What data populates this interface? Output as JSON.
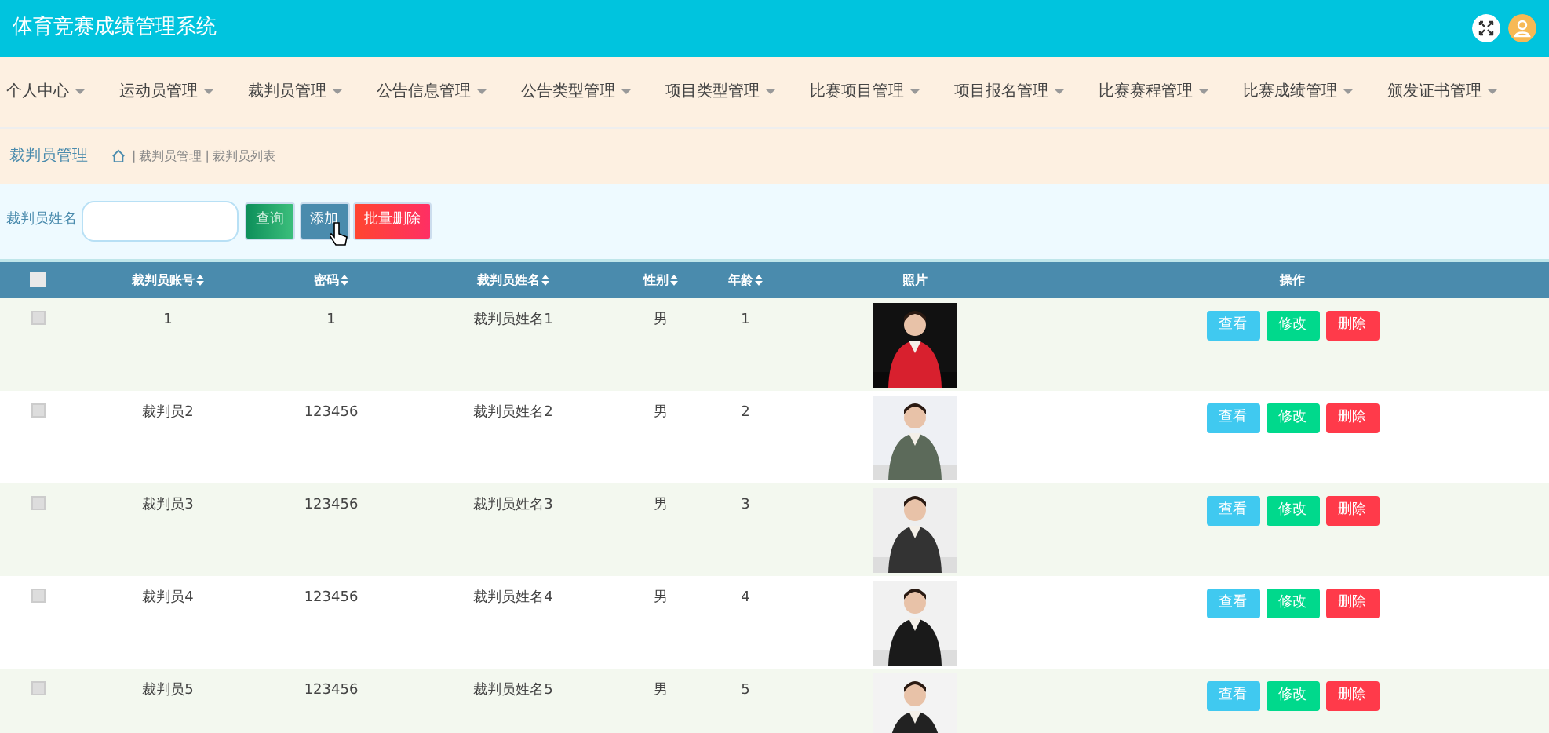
{
  "header": {
    "title": "体育竞赛成绩管理系统"
  },
  "nav": [
    "个人中心",
    "运动员管理",
    "裁判员管理",
    "公告信息管理",
    "公告类型管理",
    "项目类型管理",
    "比赛项目管理",
    "项目报名管理",
    "比赛赛程管理",
    "比赛成绩管理",
    "颁发证书管理"
  ],
  "breadcrumb": {
    "title": "裁判员管理",
    "separator": "|",
    "path": [
      "裁判员管理",
      "裁判员列表"
    ]
  },
  "search": {
    "label": "裁判员姓名",
    "buttons": [
      {
        "kind": "search",
        "label": "查询"
      },
      {
        "kind": "add",
        "label": "添加"
      },
      {
        "kind": "delete",
        "label": "批量删除"
      }
    ]
  },
  "table": {
    "header_checked": false,
    "columns": [
      {
        "label": "裁判员账号",
        "sortable": true
      },
      {
        "label": "密码",
        "sortable": true
      },
      {
        "label": "裁判员姓名",
        "sortable": true
      },
      {
        "label": "性别",
        "sortable": true
      },
      {
        "label": "年龄",
        "sortable": true
      },
      {
        "label": "照片",
        "sortable": false
      },
      {
        "label": "操作",
        "sortable": false
      }
    ],
    "rows": [
      {
        "checked": false,
        "cells": [
          "1",
          "1",
          "裁判员姓名1",
          "男",
          "1"
        ],
        "actions": [
          {
            "kind": "view",
            "label": "查看"
          },
          {
            "kind": "edit",
            "label": "修改"
          },
          {
            "kind": "delete",
            "label": "删除"
          }
        ]
      },
      {
        "checked": false,
        "cells": [
          "裁判员2",
          "123456",
          "裁判员姓名2",
          "男",
          "2"
        ],
        "actions": [
          {
            "kind": "view",
            "label": "查看"
          },
          {
            "kind": "edit",
            "label": "修改"
          },
          {
            "kind": "delete",
            "label": "删除"
          }
        ]
      },
      {
        "checked": false,
        "cells": [
          "裁判员3",
          "123456",
          "裁判员姓名3",
          "男",
          "3"
        ],
        "actions": [
          {
            "kind": "view",
            "label": "查看"
          },
          {
            "kind": "edit",
            "label": "修改"
          },
          {
            "kind": "delete",
            "label": "删除"
          }
        ]
      },
      {
        "checked": false,
        "cells": [
          "裁判员4",
          "123456",
          "裁判员姓名4",
          "男",
          "4"
        ],
        "actions": [
          {
            "kind": "view",
            "label": "查看"
          },
          {
            "kind": "edit",
            "label": "修改"
          },
          {
            "kind": "delete",
            "label": "删除"
          }
        ]
      },
      {
        "checked": false,
        "cells": [
          "裁判员5",
          "123456",
          "裁判员姓名5",
          "男",
          "5"
        ],
        "actions": [
          {
            "kind": "view",
            "label": "查看"
          },
          {
            "kind": "edit",
            "label": "修改"
          },
          {
            "kind": "delete",
            "label": "删除"
          }
        ]
      }
    ]
  }
}
